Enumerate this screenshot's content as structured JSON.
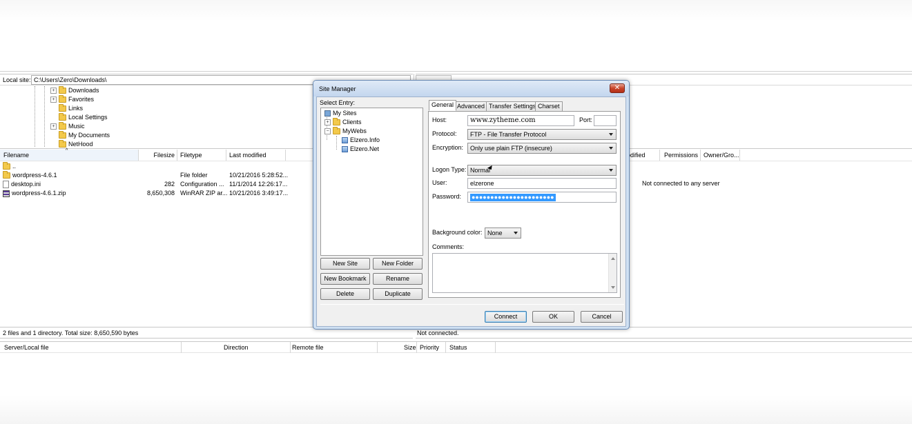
{
  "local_site": {
    "label": "Local site:",
    "path": "C:\\Users\\Zero\\Downloads\\"
  },
  "local_tree": [
    {
      "label": "Downloads",
      "expander": "+"
    },
    {
      "label": "Favorites",
      "expander": "+"
    },
    {
      "label": "Links",
      "expander": ""
    },
    {
      "label": "Local Settings",
      "expander": ""
    },
    {
      "label": "Music",
      "expander": "+"
    },
    {
      "label": "My Documents",
      "expander": ""
    },
    {
      "label": "NetHood",
      "expander": ""
    }
  ],
  "local_columns": {
    "filename": "Filename",
    "filesize": "Filesize",
    "filetype": "Filetype",
    "last_modified": "Last modified"
  },
  "local_files": [
    {
      "name": "..",
      "size": "",
      "type": "",
      "modified": "",
      "icon": "folder-icon"
    },
    {
      "name": "wordpress-4.6.1",
      "size": "",
      "type": "File folder",
      "modified": "10/21/2016 5:28:52...",
      "icon": "folder-icon"
    },
    {
      "name": "desktop.ini",
      "size": "282",
      "type": "Configuration ...",
      "modified": "11/1/2014 12:26:17...",
      "icon": "file-icon"
    },
    {
      "name": "wordpress-4.6.1.zip",
      "size": "8,650,308",
      "type": "WinRAR ZIP ar...",
      "modified": "10/21/2016 3:49:17...",
      "icon": "zip-icon"
    }
  ],
  "local_status": "2 files and 1 directory. Total size: 8,650,590 bytes",
  "remote_columns": {
    "modified": "odified",
    "permissions": "Permissions",
    "owner": "Owner/Gro..."
  },
  "remote_message": "Not connected to any server",
  "remote_status": "Not connected.",
  "queue_columns": {
    "server_local": "Server/Local file",
    "direction": "Direction",
    "remote_file": "Remote file",
    "size": "Size",
    "priority": "Priority",
    "status": "Status"
  },
  "dialog": {
    "title": "Site Manager",
    "close_glyph": "✕",
    "select_entry_label": "Select Entry:",
    "tree": {
      "root": "My Sites",
      "clients": "Clients",
      "mywebs": "MyWebs",
      "site1": "Elzero.Info",
      "site2": "Elzero.Net"
    },
    "buttons": {
      "new_site": "New Site",
      "new_folder": "New Folder",
      "new_bookmark": "New Bookmark",
      "rename": "Rename",
      "delete": "Delete",
      "duplicate": "Duplicate",
      "connect": "Connect",
      "ok": "OK",
      "cancel": "Cancel"
    },
    "tabs": [
      "General",
      "Advanced",
      "Transfer Settings",
      "Charset"
    ],
    "general": {
      "host_label": "Host:",
      "host_value": "www.zytheme.com",
      "port_label": "Port:",
      "port_value": "",
      "protocol_label": "Protocol:",
      "protocol_value": "FTP - File Transfer Protocol",
      "encryption_label": "Encryption:",
      "encryption_value": "Only use plain FTP (insecure)",
      "logon_label": "Logon Type:",
      "logon_value": "Normal",
      "user_label": "User:",
      "user_value": "elzerone",
      "password_label": "Password:",
      "password_value": "●●●●●●●●●●●●●●●●●●●●●●",
      "bgcolor_label": "Background color:",
      "bgcolor_value": "None",
      "comments_label": "Comments:"
    }
  }
}
